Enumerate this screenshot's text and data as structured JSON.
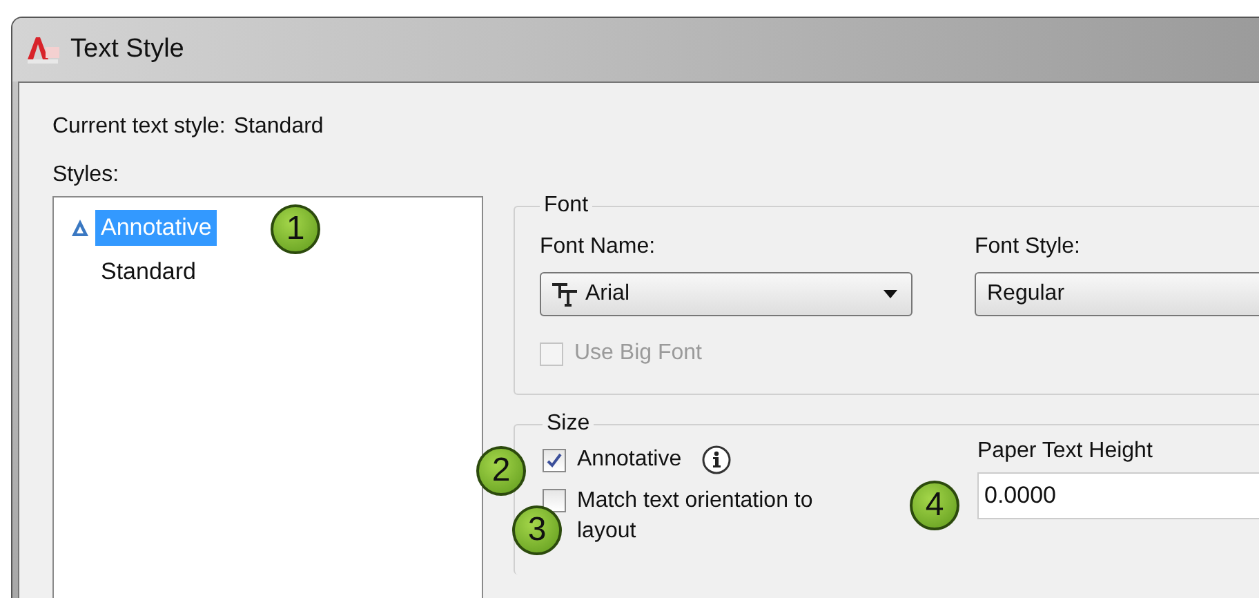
{
  "window": {
    "title": "Text Style"
  },
  "current_style": {
    "label": "Current text style:",
    "value": "Standard"
  },
  "styles": {
    "label": "Styles:",
    "items": [
      {
        "name": "Annotative",
        "annotative": true,
        "selected": true
      },
      {
        "name": "Standard",
        "annotative": false,
        "selected": false
      }
    ]
  },
  "font": {
    "group": "Font",
    "font_name": {
      "label": "Font Name:",
      "value": "Arial"
    },
    "font_style": {
      "label": "Font Style:",
      "value": "Regular"
    },
    "use_big_font": {
      "label": "Use Big Font",
      "checked": false,
      "disabled": true
    }
  },
  "size": {
    "group": "Size",
    "annotative": {
      "label": "Annotative",
      "checked": true,
      "disabled": false
    },
    "match_orientation": {
      "label": "Match text orientation to layout",
      "checked": false,
      "disabled": false
    },
    "paper_text_height": {
      "label": "Paper Text Height",
      "value": "0.0000"
    }
  },
  "callouts": [
    "1",
    "2",
    "3",
    "4"
  ]
}
